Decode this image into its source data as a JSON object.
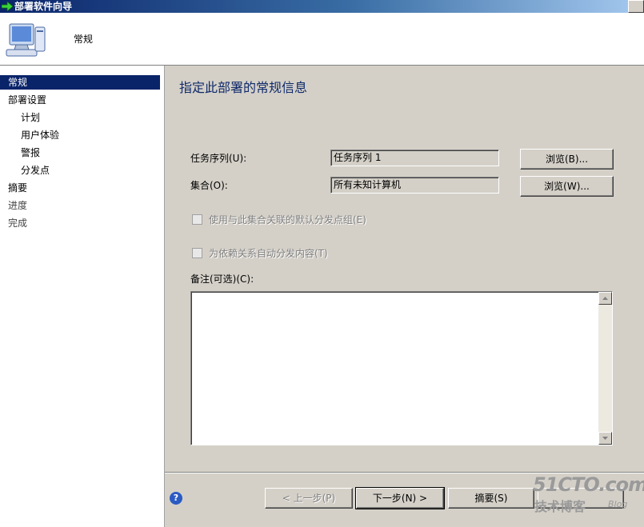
{
  "window": {
    "title": "部署软件向导"
  },
  "header": {
    "title": "常规"
  },
  "sidebar": {
    "items": [
      {
        "label": "常规"
      },
      {
        "label": "部署设置"
      },
      {
        "label": "计划"
      },
      {
        "label": "用户体验"
      },
      {
        "label": "警报"
      },
      {
        "label": "分发点"
      },
      {
        "label": "摘要"
      },
      {
        "label": "进度"
      },
      {
        "label": "完成"
      }
    ]
  },
  "main": {
    "heading": "指定此部署的常规信息",
    "task_sequence": {
      "label": "任务序列(U):",
      "value": "任务序列 1",
      "browse_label": "浏览(B)..."
    },
    "collection": {
      "label": "集合(O):",
      "value": "所有未知计算机",
      "browse_label": "浏览(W)..."
    },
    "checkbox1": {
      "label": "使用与此集合关联的默认分发点组(E)"
    },
    "checkbox2": {
      "label": "为依赖关系自动分发内容(T)"
    },
    "comments": {
      "label": "备注(可选)(C):",
      "value": ""
    }
  },
  "footer": {
    "help": "?",
    "prev_label": "< 上一步(P)",
    "next_label": "下一步(N) >",
    "summary_label": "摘要(S)",
    "cancel_label": "取消"
  },
  "watermark": {
    "site": "51CTO.com",
    "subtitle": "技术博客",
    "blog": "Blog"
  }
}
